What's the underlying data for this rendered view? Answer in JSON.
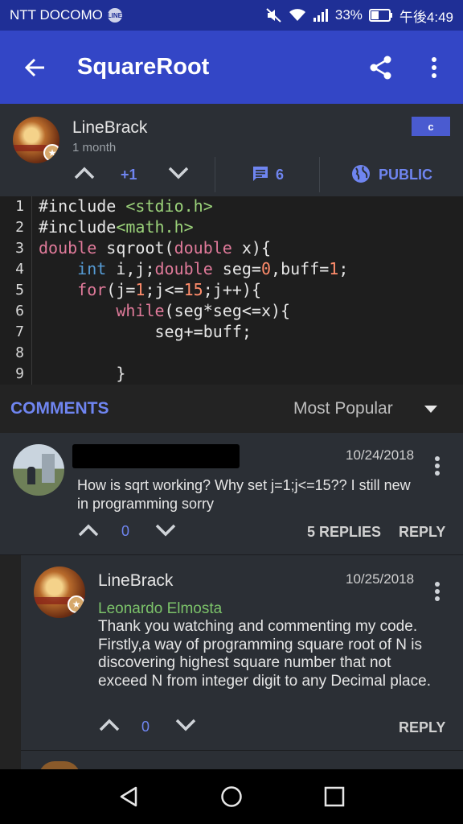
{
  "status_bar": {
    "carrier": "NTT DOCOMO",
    "carrier_badge": "LINE",
    "battery": "33%",
    "time": "午後4:49"
  },
  "app_bar": {
    "title": "SquareRoot",
    "icons": [
      "back-arrow-icon",
      "share-icon",
      "more-vert-icon"
    ]
  },
  "post": {
    "author": "LineBrack",
    "time_ago": "1 month",
    "language": "c",
    "votes": "+1",
    "comment_count": "6",
    "visibility": "PUBLIC"
  },
  "code": {
    "line_numbers": [
      "1",
      "2",
      "3",
      "4",
      "5",
      "6",
      "7",
      "8",
      "9"
    ],
    "lines": [
      "#include <stdio.h>",
      "#include<math.h>",
      "double sqroot(double x){",
      "    int i,j;double seg=0,buff=1;",
      "    for(j=1;j<=15;j++){",
      "        while(seg*seg<=x){",
      "            seg+=buff;",
      "",
      "        }"
    ]
  },
  "comments_bar": {
    "label": "COMMENTS",
    "sort": "Most Popular"
  },
  "comment": {
    "date": "10/24/2018",
    "text": "How is sqrt working? Why set j=1;j<=15?? I still new in programming sorry",
    "votes": "0",
    "replies": "5 REPLIES",
    "reply": "REPLY"
  },
  "reply": {
    "author": "LineBrack",
    "date": "10/25/2018",
    "mention": "Leonardo Elmosta",
    "text": "Thank you watching and commenting my code. Firstly,a way of programming square root of N is discovering highest square number that not exceed N from integer digit to any Decimal place.",
    "votes": "0",
    "reply": "REPLY"
  },
  "colors": {
    "status_bar": "#1f2f96",
    "app_bar": "#3346c6",
    "accent": "#6f85f0",
    "mention": "#7cc36a",
    "card": "#2b2f35"
  }
}
